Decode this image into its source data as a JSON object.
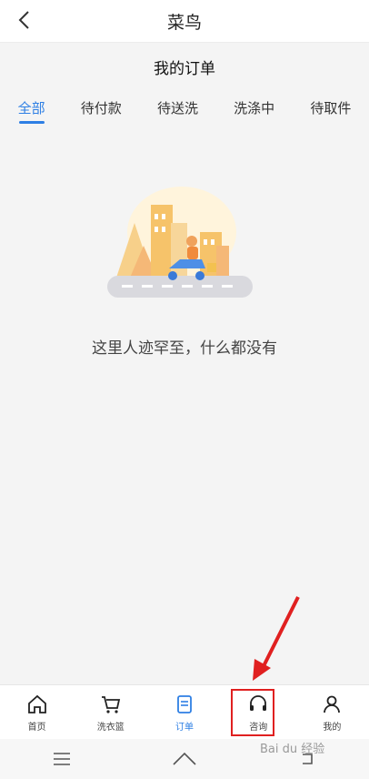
{
  "header": {
    "title": "菜鸟",
    "back_icon": "chevron-left-icon"
  },
  "page": {
    "subtitle": "我的订单"
  },
  "tabs": [
    {
      "label": "全部",
      "active": true
    },
    {
      "label": "待付款",
      "active": false
    },
    {
      "label": "待送洗",
      "active": false
    },
    {
      "label": "洗涤中",
      "active": false
    },
    {
      "label": "待取件",
      "active": false
    }
  ],
  "empty_state": {
    "message": "这里人迹罕至，什么都没有",
    "illustration": "delivery-scooter-city-illustration"
  },
  "bottom_nav": [
    {
      "label": "首页",
      "icon": "home-icon",
      "active": false
    },
    {
      "label": "洗衣篮",
      "icon": "cart-icon",
      "active": false
    },
    {
      "label": "订单",
      "icon": "order-list-icon",
      "active": true
    },
    {
      "label": "咨询",
      "icon": "headset-icon",
      "active": false
    },
    {
      "label": "我的",
      "icon": "person-icon",
      "active": false
    }
  ],
  "system_nav": [
    "menu-icon",
    "home-outline-icon",
    "back-icon"
  ],
  "watermark": "Bai du 经验",
  "colors": {
    "accent": "#2e7fe4",
    "annotation": "#e02020"
  }
}
